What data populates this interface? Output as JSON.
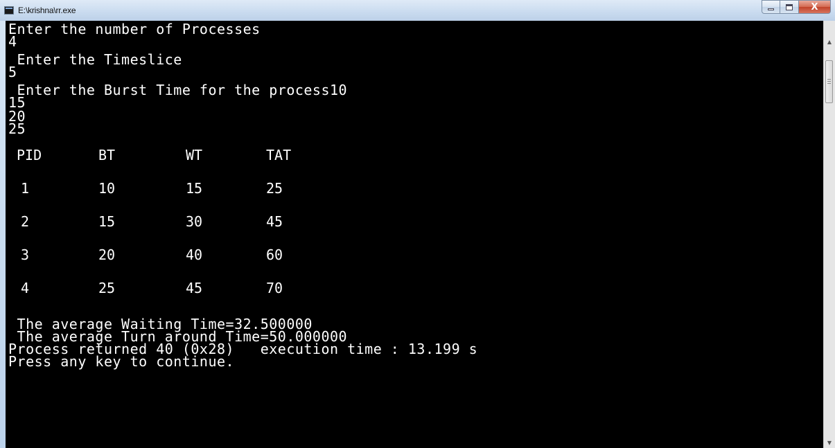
{
  "window": {
    "title": "E:\\krishna\\rr.exe",
    "controls": {
      "minimize": "—",
      "maximize": "□",
      "close": "X"
    }
  },
  "console": {
    "lines": [
      "Enter the number of Processes",
      "4",
      " Enter the Timeslice",
      "5",
      " Enter the Burst Time for the process10",
      "15",
      "20",
      "25"
    ],
    "table": {
      "headers": [
        "PID",
        "BT",
        "WT",
        "TAT"
      ],
      "rows": [
        [
          "1",
          "10",
          "15",
          "25"
        ],
        [
          "2",
          "15",
          "30",
          "45"
        ],
        [
          "3",
          "20",
          "40",
          "60"
        ],
        [
          "4",
          "25",
          "45",
          "70"
        ]
      ]
    },
    "footer": [
      " The average Waiting Time=32.500000",
      " The average Turn around Time=50.000000",
      "Process returned 40 (0x28)   execution time : 13.199 s",
      "Press any key to continue."
    ]
  },
  "colors": {
    "console_bg": "#000000",
    "console_fg": "#ffffff",
    "close_button": "#c1432a"
  }
}
